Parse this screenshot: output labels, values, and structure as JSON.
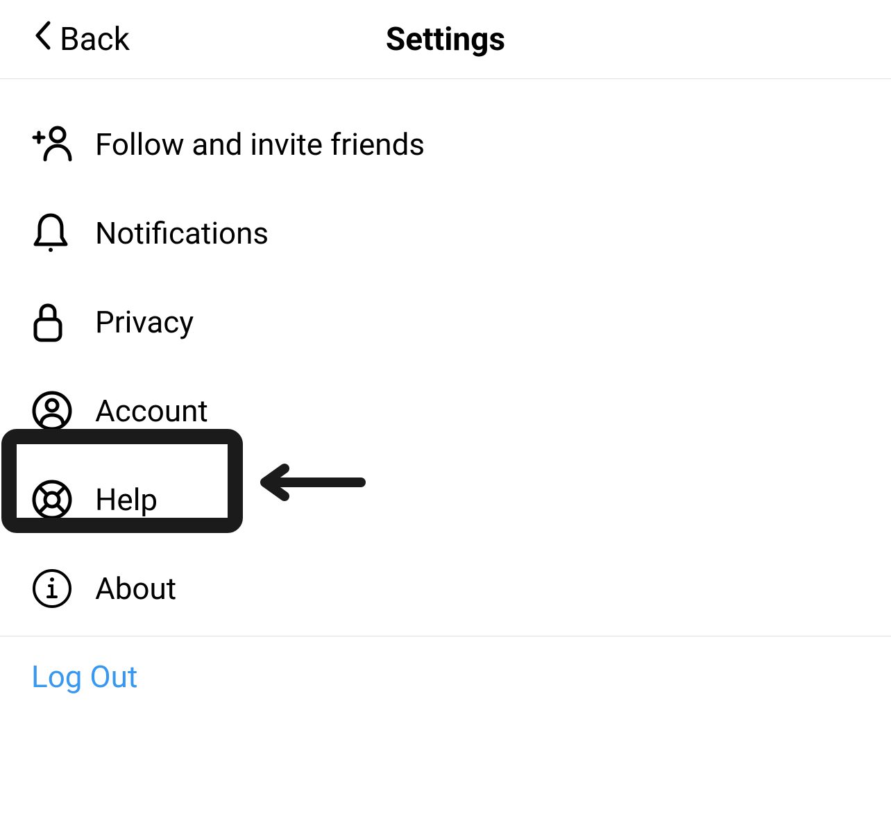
{
  "header": {
    "back_label": "Back",
    "title": "Settings"
  },
  "menu": {
    "items": [
      {
        "label": "Follow and invite friends",
        "icon": "add-user-icon"
      },
      {
        "label": "Notifications",
        "icon": "bell-icon"
      },
      {
        "label": "Privacy",
        "icon": "lock-icon"
      },
      {
        "label": "Account",
        "icon": "user-circle-icon"
      },
      {
        "label": "Help",
        "icon": "lifebuoy-icon",
        "highlighted": true
      },
      {
        "label": "About",
        "icon": "info-circle-icon"
      }
    ]
  },
  "logout_label": "Log Out",
  "colors": {
    "text": "#000000",
    "link": "#3897f0",
    "highlight": "#1b1b1b",
    "divider": "#e0e0e0"
  }
}
